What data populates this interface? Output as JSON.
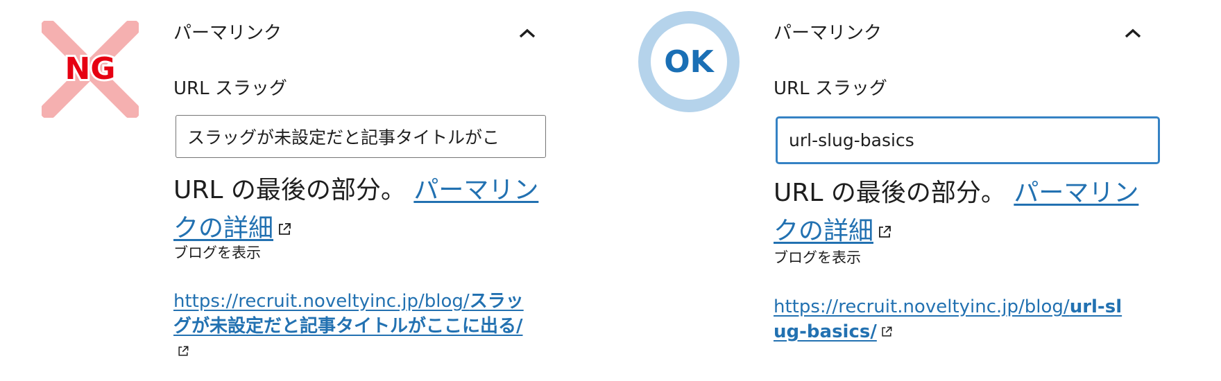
{
  "colors": {
    "link": "#2271b1",
    "focus_border": "#3582c4",
    "ng_cross": "#f5b0b0",
    "ng_text": "#e60012",
    "ok_ring": "#b5d3eb",
    "ok_text": "#1a6fb5"
  },
  "ng": {
    "badge_text": "NG",
    "section_title": "パーマリンク",
    "toggle_icon": "chevron-up-icon",
    "slug_label": "URL スラッグ",
    "slug_value": "スラッグが未設定だと記事タイトルがこ",
    "help_text": "URL の最後の部分。",
    "help_link": "パーマリンクの詳細",
    "view_label": "ブログを表示",
    "permalink_base": "https://recruit.noveltyinc.jp/blog/",
    "permalink_slug": "スラッグが未設定だと記事タイトルがここに出る/"
  },
  "ok": {
    "badge_text": "OK",
    "section_title": "パーマリンク",
    "toggle_icon": "chevron-up-icon",
    "slug_label": "URL スラッグ",
    "slug_value": "url-slug-basics",
    "help_text": "URL の最後の部分。",
    "help_link": "パーマリンクの詳細",
    "view_label": "ブログを表示",
    "permalink_base": "https://recruit.noveltyinc.jp/blog/",
    "permalink_slug": "url-slug-basics/"
  }
}
